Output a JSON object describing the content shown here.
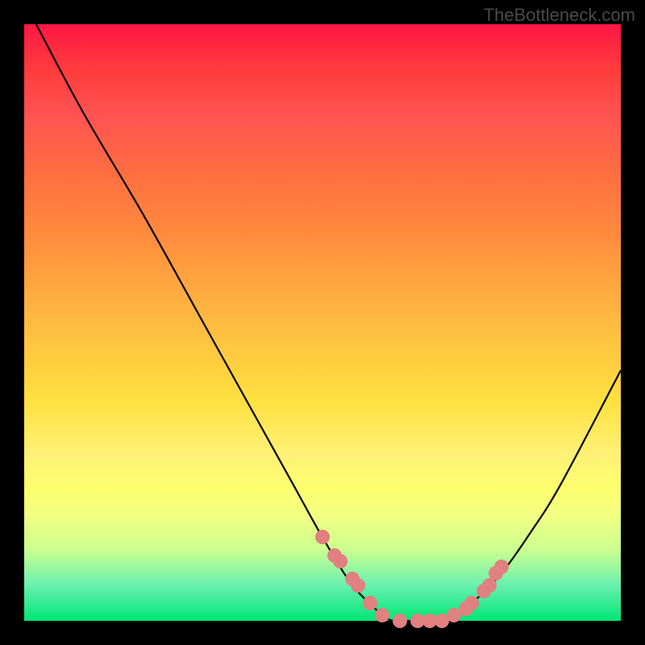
{
  "watermark": "TheBottleneck.com",
  "chart_data": {
    "type": "line",
    "title": "",
    "xlabel": "",
    "ylabel": "",
    "xlim": [
      0,
      100
    ],
    "ylim": [
      0,
      100
    ],
    "series": [
      {
        "name": "bottleneck-curve",
        "x": [
          2,
          10,
          20,
          30,
          40,
          45,
          50,
          55,
          60,
          62,
          65,
          70,
          75,
          80,
          85,
          90,
          100
        ],
        "y": [
          100,
          85,
          68,
          50,
          32,
          23,
          14,
          6,
          1,
          0,
          0,
          0,
          3,
          8,
          15,
          23,
          42
        ]
      }
    ],
    "marked_region": {
      "comment": "Dots highlighting flat/optimal zone on curve",
      "points_x": [
        50,
        52,
        53,
        55,
        56,
        58,
        60,
        63,
        66,
        68,
        70,
        72,
        74,
        75,
        77,
        78,
        79,
        80
      ],
      "points_y": [
        14,
        11,
        10,
        7,
        6,
        3,
        1,
        0,
        0,
        0,
        0,
        1,
        2,
        3,
        5,
        6,
        8,
        9
      ]
    }
  }
}
